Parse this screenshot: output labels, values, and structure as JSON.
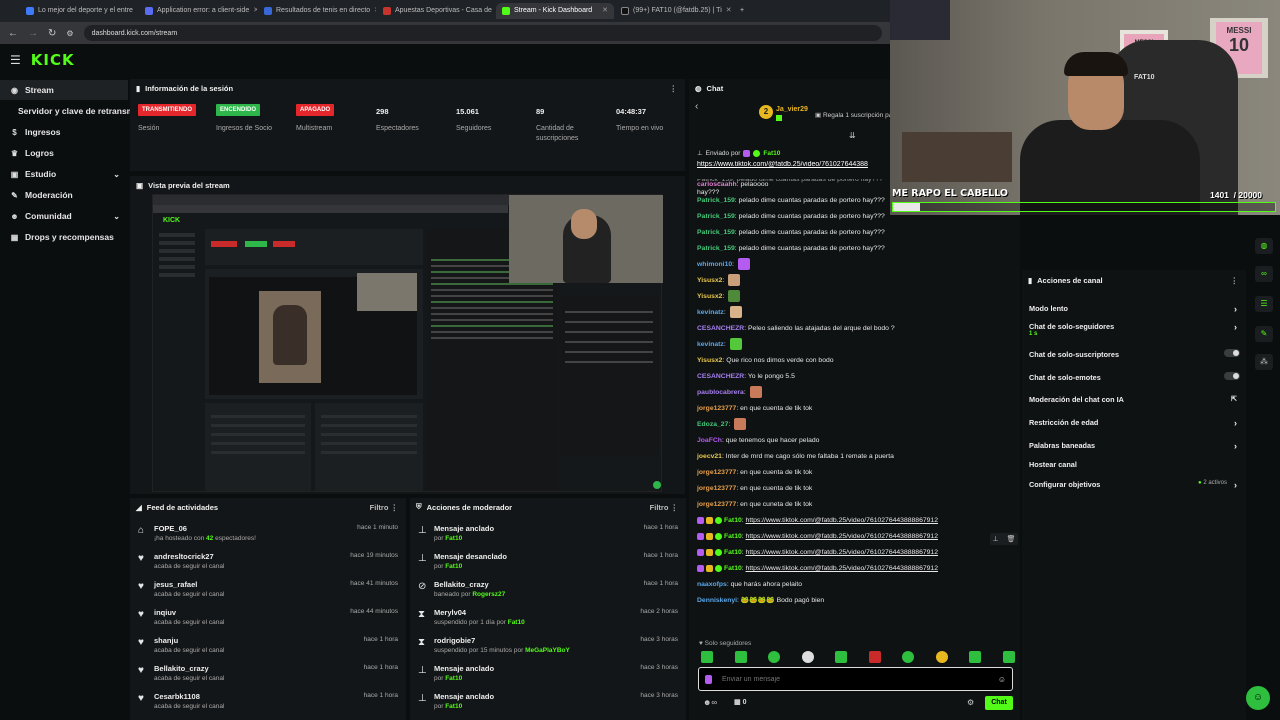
{
  "browser": {
    "tabs": [
      {
        "label": "Lo mejor del deporte y el entre",
        "color": "#3e7bfa"
      },
      {
        "label": "Application error: a client-side",
        "color": "#5a6cf0"
      },
      {
        "label": "Resultados de tenis en directo",
        "color": "#3868d8"
      },
      {
        "label": "Apuestas Deportivas - Casa de",
        "color": "#c7342c"
      },
      {
        "label": "Stream - Kick Dashboard",
        "color": "#53fc18"
      },
      {
        "label": "(99+) FAT10 (@fatdb.25) | Ti",
        "color": "#111111"
      }
    ],
    "url": "dashboard.kick.com/stream"
  },
  "brand": {
    "logo": "KICK",
    "accent": "#53fc18"
  },
  "sidebar": {
    "items": [
      {
        "label": "Stream",
        "icon": "broadcast-icon"
      },
      {
        "label": "Servidor y clave de retransmisión"
      },
      {
        "label": "Ingresos",
        "icon": "dollar-icon"
      },
      {
        "label": "Logros",
        "icon": "trophy-icon"
      },
      {
        "label": "Estudio",
        "icon": "studio-icon"
      },
      {
        "label": "Moderación",
        "icon": "wrench-icon"
      },
      {
        "label": "Comunidad",
        "icon": "people-icon"
      },
      {
        "label": "Drops y recompensas",
        "icon": "gift-icon"
      }
    ]
  },
  "session": {
    "title": "Información de la sesión",
    "stats": [
      {
        "badge": "TRANSMITIENDO",
        "badge_color": "#e5262b",
        "label": "Sesión"
      },
      {
        "badge": "ENCENDIDO",
        "badge_color": "#2fb64a",
        "label": "Ingresos de Socio"
      },
      {
        "badge": "APAGADO",
        "badge_color": "#e5262b",
        "label": "Multistream"
      },
      {
        "value": "298",
        "label": "Espectadores"
      },
      {
        "value": "15.061",
        "label": "Seguidores"
      },
      {
        "value": "89",
        "label": "Cantidad de suscripciones"
      },
      {
        "value": "04:48:37",
        "label": "Tiempo en vivo"
      }
    ]
  },
  "preview": {
    "title": "Vista previa del stream"
  },
  "activity": {
    "title": "Feed de actividades",
    "filter": "Filtro",
    "items": [
      {
        "name": "FOPE_06",
        "sub_pre": "¡ha hosteado con ",
        "sub_num": "42",
        "sub_post": " espectadores!",
        "time": "hace 1 minuto"
      },
      {
        "name": "andresltocrick27",
        "sub": "acaba de seguir el canal",
        "time": "hace 19 minutos"
      },
      {
        "name": "jesus_rafael",
        "sub": "acaba de seguir el canal",
        "time": "hace 41 minutos"
      },
      {
        "name": "inqiuv",
        "sub": "acaba de seguir el canal",
        "time": "hace 44 minutos"
      },
      {
        "name": "shanju",
        "sub": "acaba de seguir el canal",
        "time": "hace 1 hora"
      },
      {
        "name": "Bellakito_crazy",
        "sub": "acaba de seguir el canal",
        "time": "hace 1 hora"
      },
      {
        "name": "Cesarbk1108",
        "sub": "acaba de seguir el canal",
        "time": "hace 1 hora"
      }
    ]
  },
  "modactions": {
    "title": "Acciones de moderador",
    "filter": "Filtro",
    "items": [
      {
        "icon": "pin-icon",
        "title": "Mensaje anclado",
        "pre": "por ",
        "who": "Fat10",
        "post": "",
        "time": "hace 1 hora"
      },
      {
        "icon": "unpin-icon",
        "title": "Mensaje desanclado",
        "pre": "por ",
        "who": "Fat10",
        "post": "",
        "time": "hace 1 hora"
      },
      {
        "icon": "ban-icon",
        "title": "Bellakito_crazy",
        "pre": "baneado por ",
        "who": "Rogersz27",
        "post": "",
        "time": "hace 1 hora"
      },
      {
        "icon": "hourglass-icon",
        "title": "Merylv04",
        "pre": "suspendido por 1 día por ",
        "who": "Fat10",
        "post": "",
        "time": "hace 2 horas"
      },
      {
        "icon": "hourglass-icon",
        "title": "rodrigobie7",
        "pre": "suspendido por 15 minutos por ",
        "who": "MeGaPlaYBoY",
        "post": "",
        "time": "hace 3 horas"
      },
      {
        "icon": "pin-icon",
        "title": "Mensaje anclado",
        "pre": "por ",
        "who": "Fat10",
        "post": "",
        "time": "hace 3 horas"
      },
      {
        "icon": "pin-icon",
        "title": "Mensaje anclado",
        "pre": "por ",
        "who": "Fat10",
        "post": "",
        "time": "hace 3 horas"
      }
    ]
  },
  "chat": {
    "title": "Chat",
    "gifter": "Ja_vier29",
    "gifter_count": "2",
    "gift_text": "Regala 1 suscripción pa",
    "pinned_by_label": "Enviado por",
    "pinned_by": "Fat10",
    "pinned_link": "https://www.tiktok.com/@fatdb.25/video/761027644388",
    "partial_line": "Patrick_159: pelado dime cuantas paradas de portero hay???",
    "partial_line2": "hay???",
    "messages": [
      {
        "user": "carloscaahh",
        "color": "#e07bd0",
        "text": "pelaoooo"
      },
      {
        "user": "Patrick_159",
        "color": "#46c87a",
        "text": "pelado dime cuantas paradas de portero hay???"
      },
      {
        "user": "Patrick_159",
        "color": "#46c87a",
        "text": "pelado dime cuantas paradas de portero hay???"
      },
      {
        "user": "Patrick_159",
        "color": "#46c87a",
        "text": "pelado dime cuantas paradas de portero hay???"
      },
      {
        "user": "Patrick_159",
        "color": "#46c87a",
        "text": "pelado dime cuantas paradas de portero hay???"
      },
      {
        "user": "whimoni10",
        "color": "#5aa7e8",
        "text": "",
        "emote": "#b45cf0"
      },
      {
        "user": "Yisusx2",
        "color": "#e8c84a",
        "text": "",
        "emote": "#c9a07a"
      },
      {
        "user": "Yisusx2",
        "color": "#e8c84a",
        "text": "",
        "emote": "#4f8a3b"
      },
      {
        "user": "kevinatz",
        "color": "#5aa7e8",
        "text": "",
        "emote": "#d8b28a"
      },
      {
        "user": "CESANCHEZR",
        "color": "#a67ef0",
        "text": "Peleo saliendo las atajadas del arque del bodo ?"
      },
      {
        "user": "kevinatz",
        "color": "#5aa7e8",
        "text": "",
        "emote": "#53c83a"
      },
      {
        "user": "Yisusx2",
        "color": "#e8c84a",
        "text": "Que rico nos dimos verde con bodo"
      },
      {
        "user": "CESANCHEZR",
        "color": "#a67ef0",
        "text": "Yo le pongo 5.5"
      },
      {
        "user": "paublocabrera",
        "color": "#a67ef0",
        "text": "",
        "emote": "#c87a5a"
      },
      {
        "user": "jorge123777",
        "color": "#e8a04a",
        "text": "en que cuenta de tik tok"
      },
      {
        "user": "Edoza_27",
        "color": "#46c87a",
        "text": "",
        "emote": "#c87a5a"
      },
      {
        "user": "JoaFCh",
        "color": "#b45cf0",
        "text": "que tenemos que hacer pelado"
      },
      {
        "user": "joecv21",
        "color": "#e8c84a",
        "text": "Inter de mrd me cago sólo me faltaba 1 remate a puerta"
      },
      {
        "user": "jorge123777",
        "color": "#e8a04a",
        "text": "en que cuenta de tik tok"
      },
      {
        "user": "jorge123777",
        "color": "#e8a04a",
        "text": "en que cuenta de tik tok"
      },
      {
        "user": "jorge123777",
        "color": "#e8a04a",
        "text": "en que cuneta de tik tok"
      },
      {
        "user": "Fat10",
        "color": "#53fc18",
        "text": "",
        "link": "https://www.tiktok.com/@fatdb.25/video/7610276443888867912",
        "badges": true
      },
      {
        "user": "Fat10",
        "color": "#53fc18",
        "text": "",
        "link": "https://www.tiktok.com/@fatdb.25/video/7610276443888867912",
        "badges": true
      },
      {
        "user": "Fat10",
        "color": "#53fc18",
        "text": "",
        "link": "https://www.tiktok.com/@fatdb.25/video/7610276443888867912",
        "badges": true
      },
      {
        "user": "Fat10",
        "color": "#53fc18",
        "text": "",
        "link": "https://www.tiktok.com/@fatdb.25/video/7610276443888867912",
        "badges": true
      },
      {
        "user": "naaxofps",
        "color": "#5aa7e8",
        "text": "que harás ahora pelaito"
      },
      {
        "user": "Denniskenyi",
        "color": "#5aa7e8",
        "text": "🐸🐸🐸🐸 Bodo pagó bien"
      }
    ],
    "followers_only": "Solo seguidores",
    "input_placeholder": "Enviar un mensaje",
    "send_label": "Chat",
    "count": "0"
  },
  "channel_actions": {
    "title": "Acciones de canal",
    "items": [
      {
        "label": "Modo lento",
        "control": "chevron"
      },
      {
        "label": "Chat de solo-seguidores",
        "sub": "1 s",
        "control": "chevron"
      },
      {
        "label": "Chat de solo-suscriptores",
        "control": "toggle"
      },
      {
        "label": "Chat de solo-emotes",
        "control": "toggle"
      },
      {
        "label": "Moderación del chat con IA",
        "control": "external"
      },
      {
        "label": "Restricción de edad",
        "control": "chevron"
      },
      {
        "label": "Palabras baneadas",
        "control": "chevron"
      },
      {
        "label": "Hostear canal",
        "control": "none"
      },
      {
        "label": "Configurar objetivos",
        "control": "chevron",
        "extra": "2 activos"
      }
    ]
  },
  "overlay": {
    "title": "ME RAPO EL CABELLO",
    "progress_current": "1401",
    "progress_total": "/ 20000",
    "progress_fraction": 0.07,
    "jersey_top": "MESSI",
    "jersey_number": "10",
    "chair_text": "FAT10"
  }
}
